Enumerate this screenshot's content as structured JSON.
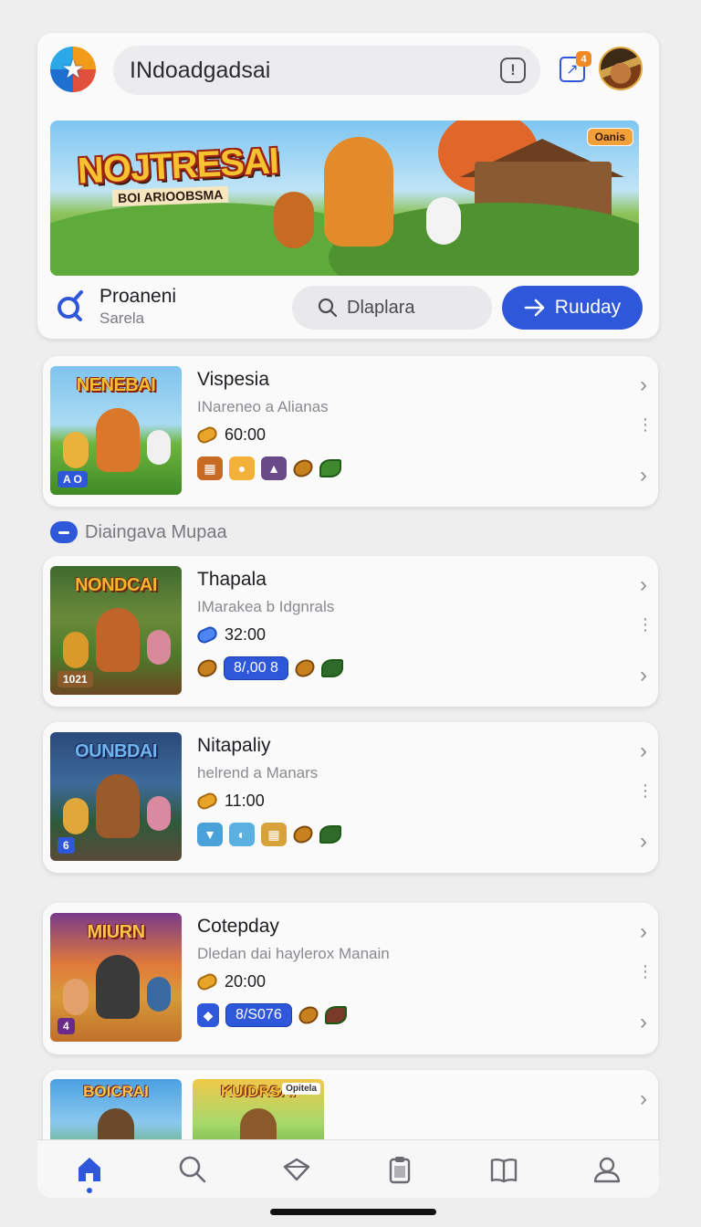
{
  "header": {
    "search_value": "INdoadgadsai",
    "edit_badge": "4"
  },
  "banner": {
    "title": "NOJTRESAI",
    "subtitle": "BOI ARIOOBSMA",
    "badge": "Oanis"
  },
  "profile": {
    "name": "Proaneni",
    "sub": "Sarela"
  },
  "actions": {
    "secondary_label": "Dlaplara",
    "primary_label": "Ruuday"
  },
  "section_label": "Diaingava Mupaa",
  "games": [
    {
      "name": "Vispesia",
      "desc": "INareneo a Alianas",
      "time": "60:00",
      "thumb_title": "NENEBAI",
      "thumb_tag": "A O",
      "chip": ""
    },
    {
      "name": "Thapala",
      "desc": "IMarakea b Idgnrals",
      "time": "32:00",
      "thumb_title": "NONDCAI",
      "thumb_tag": "1021",
      "chip": "8/,00 8"
    },
    {
      "name": "Nitapaliy",
      "desc": "helrend a Manars",
      "time": "11:00",
      "thumb_title": "OUNBDAI",
      "thumb_tag": "6",
      "chip": ""
    },
    {
      "name": "Cotepday",
      "desc": "Dledan dai haylerox Manain",
      "time": "20:00",
      "thumb_title": "MIURN",
      "thumb_tag": "4",
      "chip": "8/S076"
    }
  ],
  "partial_cards": [
    {
      "thumb_title": "BOICRAI"
    },
    {
      "thumb_title": "KUIDRSAI",
      "badge": "Opitela"
    }
  ],
  "nav": [
    "home",
    "search",
    "explore",
    "clipboard",
    "library",
    "profile"
  ],
  "colors": {
    "accent": "#2f57d9",
    "background": "#eeeeef",
    "card": "#fafafa"
  }
}
